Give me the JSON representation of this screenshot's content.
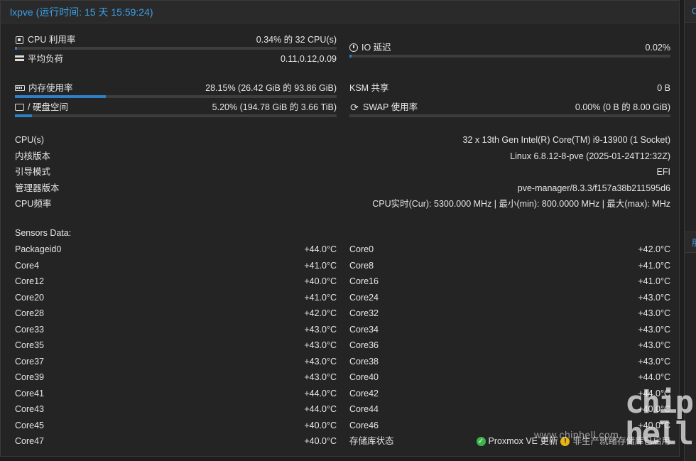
{
  "header": {
    "title": "lxpve (运行时间: 15 天 15:59:24)"
  },
  "right_panel": {
    "title": "C",
    "title2": "朋"
  },
  "metrics": {
    "cpu": {
      "label": "CPU 利用率",
      "value": "0.34% 的 32 CPU(s)",
      "icon": "cpu-icon",
      "fraction": 0.0034
    },
    "load": {
      "label": "平均负荷",
      "value": "0.11,0.12,0.09",
      "icon": "load-icon"
    },
    "io": {
      "label": "IO 延迟",
      "value": "0.02%",
      "icon": "clock-icon",
      "fraction": 0.0002
    },
    "memory": {
      "label": "内存使用率",
      "value": "28.15% (26.42 GiB 的 93.86 GiB)",
      "icon": "memory-icon",
      "fraction": 0.2815
    },
    "ksm": {
      "label": "KSM 共享",
      "value": "0 B"
    },
    "disk": {
      "label": "/ 硬盘空间",
      "value": "5.20% (194.78 GiB 的 3.66 TiB)",
      "icon": "hdd-icon",
      "fraction": 0.052
    },
    "swap": {
      "label": "SWAP 使用率",
      "value": "0.00% (0 B 的 8.00 GiB)",
      "icon": "refresh-icon",
      "fraction": 0.0
    }
  },
  "info": [
    {
      "label": "CPU(s)",
      "value": "32 x 13th Gen Intel(R) Core(TM) i9-13900 (1 Socket)"
    },
    {
      "label": "内核版本",
      "value": "Linux 6.8.12-8-pve (2025-01-24T12:32Z)"
    },
    {
      "label": "引导模式",
      "value": "EFI"
    },
    {
      "label": "管理器版本",
      "value": "pve-manager/8.3.3/f157a38b211595d6"
    },
    {
      "label": "CPU频率",
      "value": "CPU实时(Cur): 5300.000 MHz | 最小(min): 800.0000 MHz | 最大(max): MHz"
    }
  ],
  "sensors": {
    "title": "Sensors Data:",
    "left": [
      {
        "name": "Packageid0",
        "temp": "+44.0°C"
      },
      {
        "name": "Core4",
        "temp": "+41.0°C"
      },
      {
        "name": "Core12",
        "temp": "+40.0°C"
      },
      {
        "name": "Core20",
        "temp": "+41.0°C"
      },
      {
        "name": "Core28",
        "temp": "+42.0°C"
      },
      {
        "name": "Core33",
        "temp": "+43.0°C"
      },
      {
        "name": "Core35",
        "temp": "+43.0°C"
      },
      {
        "name": "Core37",
        "temp": "+43.0°C"
      },
      {
        "name": "Core39",
        "temp": "+43.0°C"
      },
      {
        "name": "Core41",
        "temp": "+44.0°C"
      },
      {
        "name": "Core43",
        "temp": "+44.0°C"
      },
      {
        "name": "Core45",
        "temp": "+40.0°C"
      },
      {
        "name": "Core47",
        "temp": "+40.0°C"
      }
    ],
    "right": [
      {
        "name": "Core0",
        "temp": "+42.0°C"
      },
      {
        "name": "Core8",
        "temp": "+41.0°C"
      },
      {
        "name": "Core16",
        "temp": "+41.0°C"
      },
      {
        "name": "Core24",
        "temp": "+43.0°C"
      },
      {
        "name": "Core32",
        "temp": "+43.0°C"
      },
      {
        "name": "Core34",
        "temp": "+43.0°C"
      },
      {
        "name": "Core36",
        "temp": "+43.0°C"
      },
      {
        "name": "Core38",
        "temp": "+43.0°C"
      },
      {
        "name": "Core40",
        "temp": "+44.0°C"
      },
      {
        "name": "Core42",
        "temp": "+44.0°C"
      },
      {
        "name": "Core44",
        "temp": "+40.0°C"
      },
      {
        "name": "Core46",
        "temp": "+40.0°C"
      }
    ]
  },
  "repo_status": {
    "label": "存储库状态",
    "ok_text": "Proxmox VE 更新",
    "warn_text": "非生产就绪存储库已启用",
    "ok_icon": "check-circle-icon",
    "warn_icon": "warning-icon"
  },
  "watermark": {
    "text": "www.chiphell.com",
    "logo": "chip hell"
  },
  "colors": {
    "accent": "#3ba0e6",
    "bar_fill": "#2d7fc6",
    "ok": "#3bb54a",
    "warn": "#e7b416"
  }
}
